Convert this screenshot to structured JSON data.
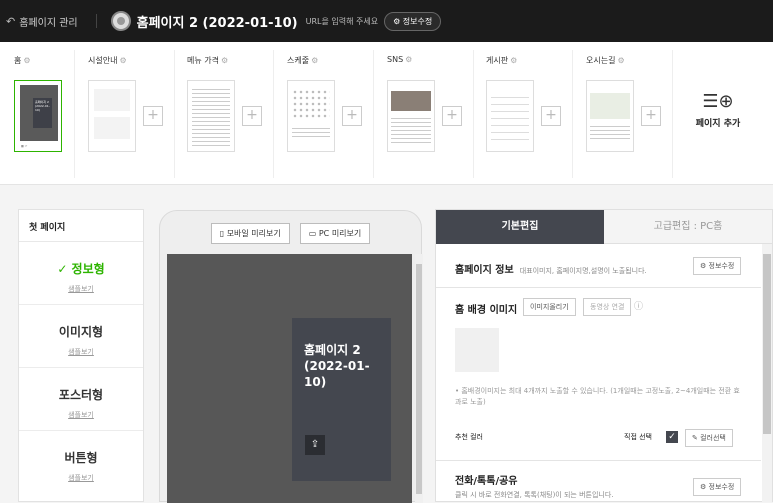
{
  "topbar": {
    "back_label": "홈페이지 관리",
    "site_title": "홈페이지 2 (2022-01-10)",
    "url_hint": "URL을 입력해 주세요",
    "info_button": "정보수정"
  },
  "pages": [
    {
      "name": "홈",
      "active": true
    },
    {
      "name": "시설안내",
      "active": false
    },
    {
      "name": "메뉴 가격",
      "active": false
    },
    {
      "name": "스케줄",
      "active": false
    },
    {
      "name": "SNS",
      "active": false
    },
    {
      "name": "게시판",
      "active": false
    },
    {
      "name": "오시는길",
      "active": false
    }
  ],
  "home_thumb": {
    "title": "홈페이지 2 (2022-01-10)"
  },
  "add_page_label": "페이지 추가",
  "left_panel": {
    "title": "첫 페이지",
    "items": [
      {
        "name": "정보형",
        "sample": "샘플보기",
        "selected": true
      },
      {
        "name": "이미지형",
        "sample": "샘플보기",
        "selected": false
      },
      {
        "name": "포스터형",
        "sample": "샘플보기",
        "selected": false
      },
      {
        "name": "버튼형",
        "sample": "샘플보기",
        "selected": false
      }
    ]
  },
  "preview": {
    "mobile_btn": "모바일 미리보기",
    "pc_btn": "PC 미리보기",
    "card_title": "홈페이지 2 (2022-01-10)"
  },
  "right_panel": {
    "tab_basic": "기본편집",
    "tab_advanced": "고급편집 : PC홈",
    "info_section": {
      "title": "홈페이지 정보",
      "desc": "대표이미지, 홈페이지명,설명이 노출됩니다.",
      "button": "정보수정"
    },
    "bg_section": {
      "title": "홈 배경 이미지",
      "upload_btn": "이미지올리기",
      "video_btn": "동영상 연결",
      "note": "홈배경이미지는 최대 4개까지 노출할 수 있습니다. (1개일때는 고정노출, 2~4개일때는 전환 효과로 노출)",
      "color_label": "추천 컬러",
      "direct_select": "직접 선택",
      "color_btn": "컬러선택"
    },
    "contact_section": {
      "title": "전화/톡톡/공유",
      "desc": "클릭 시 바로 전화연결, 톡톡(채팅)이 되는 버튼입니다.",
      "button": "정보수정"
    }
  },
  "colors": {
    "accent": "#2db400",
    "topbar": "#1b1b1b",
    "panel_dark": "#44474f"
  }
}
